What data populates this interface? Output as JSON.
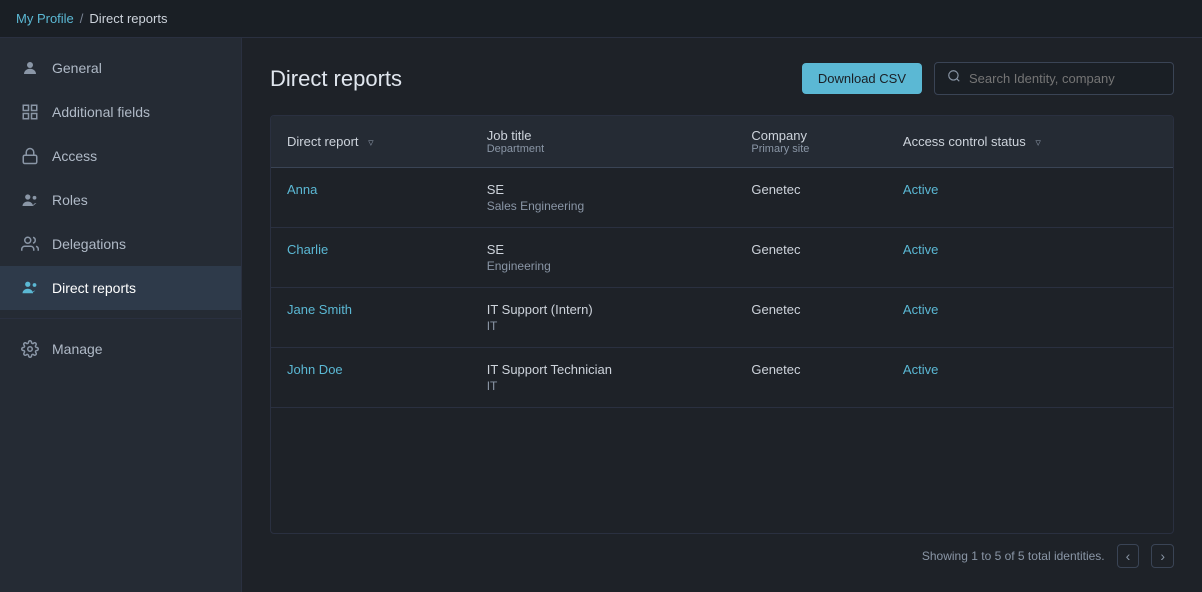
{
  "breadcrumb": {
    "link_label": "My Profile",
    "separator": "/",
    "current": "Direct reports"
  },
  "sidebar": {
    "items": [
      {
        "id": "general",
        "label": "General",
        "icon": "person-icon",
        "active": false
      },
      {
        "id": "additional-fields",
        "label": "Additional fields",
        "icon": "grid-icon",
        "active": false
      },
      {
        "id": "access",
        "label": "Access",
        "icon": "access-icon",
        "active": false
      },
      {
        "id": "roles",
        "label": "Roles",
        "icon": "roles-icon",
        "active": false
      },
      {
        "id": "delegations",
        "label": "Delegations",
        "icon": "delegations-icon",
        "active": false
      },
      {
        "id": "direct-reports",
        "label": "Direct reports",
        "icon": "direct-reports-icon",
        "active": true
      },
      {
        "id": "manage",
        "label": "Manage",
        "icon": "manage-icon",
        "active": false
      }
    ]
  },
  "page": {
    "title": "Direct reports",
    "download_btn": "Download CSV",
    "search_placeholder": "Search Identity, company"
  },
  "table": {
    "columns": [
      {
        "label": "Direct report",
        "sublabel": "",
        "has_filter": true
      },
      {
        "label": "Job title",
        "sublabel": "Department",
        "has_filter": false
      },
      {
        "label": "Company",
        "sublabel": "Primary site",
        "has_filter": false
      },
      {
        "label": "Access control status",
        "sublabel": "",
        "has_filter": true
      }
    ],
    "rows": [
      {
        "name": "Anna",
        "job_title": "SE",
        "department": "Sales Engineering",
        "company": "Genetec",
        "primary_site": "",
        "status": "Active"
      },
      {
        "name": "Charlie",
        "job_title": "SE",
        "department": "Engineering",
        "company": "Genetec",
        "primary_site": "",
        "status": "Active"
      },
      {
        "name": "Jane Smith",
        "job_title": "IT Support (Intern)",
        "department": "IT",
        "company": "Genetec",
        "primary_site": "",
        "status": "Active"
      },
      {
        "name": "John Doe",
        "job_title": "IT Support Technician",
        "department": "IT",
        "company": "Genetec",
        "primary_site": "",
        "status": "Active"
      }
    ]
  },
  "footer": {
    "showing_text": "Showing 1 to 5 of 5 total identities."
  }
}
